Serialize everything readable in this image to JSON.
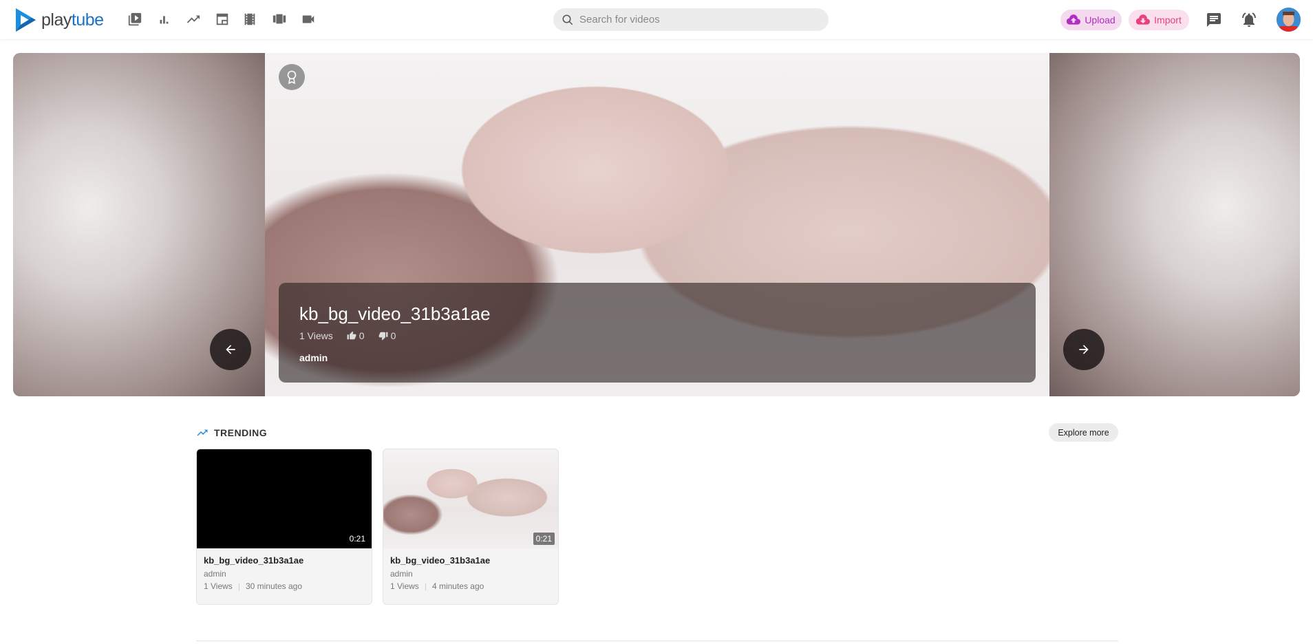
{
  "header": {
    "logo": {
      "part1": "play",
      "part2": "tube"
    },
    "nav_icons": [
      "library-icon",
      "chart-icon",
      "trending-icon",
      "news-icon",
      "film-icon",
      "carousel-icon",
      "video-camera-icon"
    ],
    "search": {
      "placeholder": "Search for videos",
      "value": ""
    },
    "upload_label": "Upload",
    "import_label": "Import",
    "colors": {
      "brand": "#1a73c8",
      "upload": "#b02ec0",
      "import": "#e9417a"
    }
  },
  "hero": {
    "title": "kb_bg_video_31b3a1ae",
    "views": "1 Views",
    "likes": "0",
    "dislikes": "0",
    "owner": "admin"
  },
  "trending": {
    "title": "TRENDING",
    "explore_label": "Explore more",
    "videos": [
      {
        "title": "kb_bg_video_31b3a1ae",
        "owner": "admin",
        "views": "1 Views",
        "time": "30 minutes ago",
        "duration": "0:21"
      },
      {
        "title": "kb_bg_video_31b3a1ae",
        "owner": "admin",
        "views": "1 Views",
        "time": "4 minutes ago",
        "duration": "0:21"
      }
    ]
  }
}
